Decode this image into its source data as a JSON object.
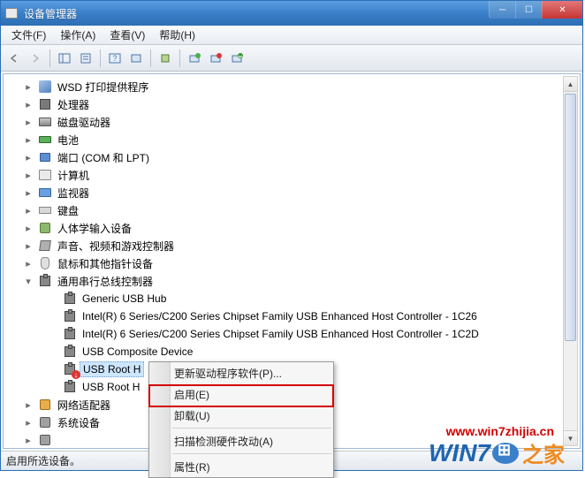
{
  "window": {
    "title": "设备管理器"
  },
  "menubar": {
    "file": "文件(F)",
    "action": "操作(A)",
    "view": "查看(V)",
    "help": "帮助(H)"
  },
  "tree": {
    "items": [
      {
        "label": "WSD 打印提供程序",
        "icon": "device"
      },
      {
        "label": "处理器",
        "icon": "cpu"
      },
      {
        "label": "磁盘驱动器",
        "icon": "disk"
      },
      {
        "label": "电池",
        "icon": "battery"
      },
      {
        "label": "端口 (COM 和 LPT)",
        "icon": "port"
      },
      {
        "label": "计算机",
        "icon": "computer"
      },
      {
        "label": "监视器",
        "icon": "monitor"
      },
      {
        "label": "键盘",
        "icon": "keyboard"
      },
      {
        "label": "人体学输入设备",
        "icon": "hid"
      },
      {
        "label": "声音、视频和游戏控制器",
        "icon": "sound"
      },
      {
        "label": "鼠标和其他指针设备",
        "icon": "mouse"
      },
      {
        "label": "通用串行总线控制器",
        "icon": "usb",
        "expanded": true,
        "children": [
          {
            "label": "Generic USB Hub"
          },
          {
            "label": "Intel(R) 6 Series/C200 Series Chipset Family USB Enhanced Host Controller - 1C26"
          },
          {
            "label": "Intel(R) 6 Series/C200 Series Chipset Family USB Enhanced Host Controller - 1C2D"
          },
          {
            "label": "USB Composite Device"
          },
          {
            "label": "USB Root H",
            "selected": true,
            "disabled": true
          },
          {
            "label": "USB Root H"
          }
        ]
      },
      {
        "label": "网络适配器",
        "icon": "net"
      },
      {
        "label": "系统设备",
        "icon": "sys"
      },
      {
        "label": "",
        "icon": "sys"
      }
    ]
  },
  "context_menu": {
    "update_driver": "更新驱动程序软件(P)...",
    "enable": "启用(E)",
    "uninstall": "卸载(U)",
    "scan_hw": "扫描检测硬件改动(A)",
    "properties": "属性(R)"
  },
  "statusbar": {
    "text": "启用所选设备。"
  },
  "watermark": {
    "url": "www.win7zhijia.cn",
    "logo_main": "WIN7",
    "logo_sub": "之家"
  }
}
